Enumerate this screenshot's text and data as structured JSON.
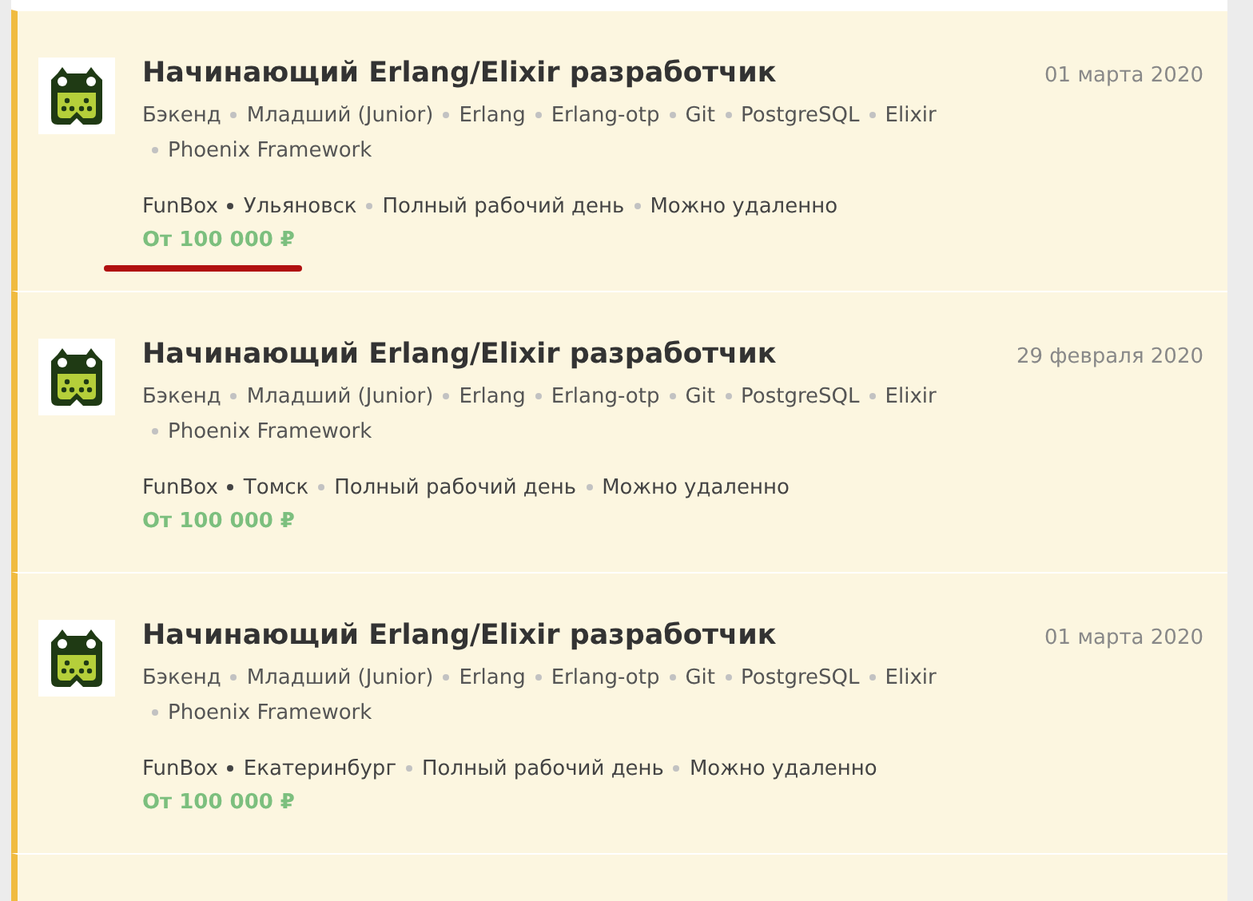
{
  "vacancies": [
    {
      "title": "Начинающий Erlang/Elixir разработчик",
      "date": "01 марта 2020",
      "tags": [
        "Бэкенд",
        "Младший (Junior)",
        "Erlang",
        "Erlang-otp",
        "Git",
        "PostgreSQL",
        "Elixir",
        "Phoenix Framework"
      ],
      "company": "FunBox",
      "details": [
        "Ульяновск",
        "Полный рабочий день",
        "Можно удаленно"
      ],
      "salary": "От 100 000 ₽",
      "underlined": true
    },
    {
      "title": "Начинающий Erlang/Elixir разработчик",
      "date": "29 февраля 2020",
      "tags": [
        "Бэкенд",
        "Младший (Junior)",
        "Erlang",
        "Erlang-otp",
        "Git",
        "PostgreSQL",
        "Elixir",
        "Phoenix Framework"
      ],
      "company": "FunBox",
      "details": [
        "Томск",
        "Полный рабочий день",
        "Можно удаленно"
      ],
      "salary": "От 100 000 ₽",
      "underlined": false
    },
    {
      "title": "Начинающий Erlang/Elixir разработчик",
      "date": "01 марта 2020",
      "tags": [
        "Бэкенд",
        "Младший (Junior)",
        "Erlang",
        "Erlang-otp",
        "Git",
        "PostgreSQL",
        "Elixir",
        "Phoenix Framework"
      ],
      "company": "FunBox",
      "details": [
        "Екатеринбург",
        "Полный рабочий день",
        "Можно удаленно"
      ],
      "salary": "От 100 000 ₽",
      "underlined": false
    }
  ]
}
